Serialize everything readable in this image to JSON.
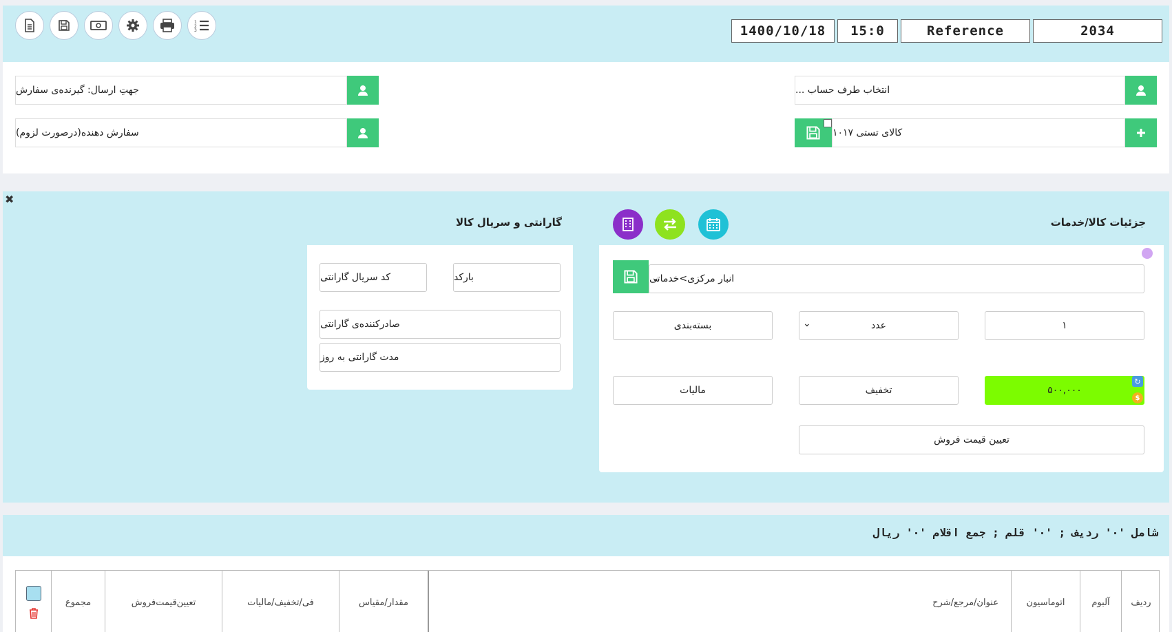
{
  "toolbar": {
    "buttons": [
      "new-document",
      "save",
      "cash",
      "settings",
      "print",
      "list"
    ]
  },
  "header": {
    "date": "1400/10/18",
    "time": "15:0",
    "reference": "Reference",
    "number": "2034"
  },
  "account": {
    "select_placeholder": "انتخاب طرف حساب ...",
    "product": "کالای تستی ۱۰۱۷",
    "ship_to": "جهتِ ارسال: گیرنده‌ی سفارش",
    "orderer": "سفارش دهنده(درصورت لزوم)"
  },
  "product_details": {
    "title": "جزئیات کالا/خدمات",
    "warehouse": "انبار مرکزی>خدماتی",
    "quantity": "۱",
    "unit": "عدد",
    "packaging": "بسته‌بندی",
    "price": "۵۰۰,۰۰۰",
    "discount": "تخفیف",
    "tax": "مالیات",
    "set_price": "تعیین قیمت فروش",
    "colors": {
      "purple": "#8b2fc9",
      "green": "#8ee21f",
      "teal": "#1fc1d6",
      "price_bg": "#7cfc00"
    }
  },
  "warranty": {
    "title": "گارانتی و سریال کالا",
    "barcode": "بارکد",
    "serial": "کد سریال گارانتی",
    "issuer": "صادرکننده‌ی گارانتی",
    "duration": "مدت گارانتی به روز"
  },
  "summary": {
    "text": "شامل '۰' ردیف ; '۰' قلم ; جمع اقلام '۰' ریال"
  },
  "table": {
    "headers": {
      "row": "ردیف",
      "album": "آلبوم",
      "automation": "اتوماسیون",
      "title": "عنوان/مرجع/شرح",
      "qty": "مقدار/مقیاس",
      "fee": "فی/تخفیف/مالیات",
      "set_price": "تعیین‌قیمت‌فروش",
      "total": "مجموع"
    }
  }
}
